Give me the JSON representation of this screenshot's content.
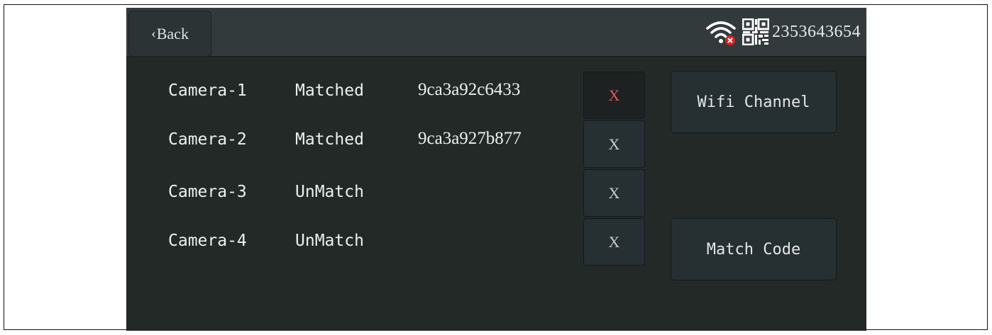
{
  "header": {
    "back_label": "Back",
    "device_id": "2353643654",
    "wifi_icon": "wifi-disconnected-icon",
    "qr_icon": "qr-code-icon"
  },
  "cameras": [
    {
      "name": "Camera-1",
      "status": "Matched",
      "id": "9ca3a92c6433",
      "remove": "X"
    },
    {
      "name": "Camera-2",
      "status": "Matched",
      "id": "9ca3a927b877",
      "remove": "X"
    },
    {
      "name": "Camera-3",
      "status": "UnMatch",
      "id": "",
      "remove": "X"
    },
    {
      "name": "Camera-4",
      "status": "UnMatch",
      "id": "",
      "remove": "X"
    }
  ],
  "actions": {
    "wifi_channel": "Wifi Channel",
    "match_code": "Match Code"
  },
  "colors": {
    "background": "#222927",
    "topbar": "#333a3c",
    "active_remove": "#e05a55"
  }
}
